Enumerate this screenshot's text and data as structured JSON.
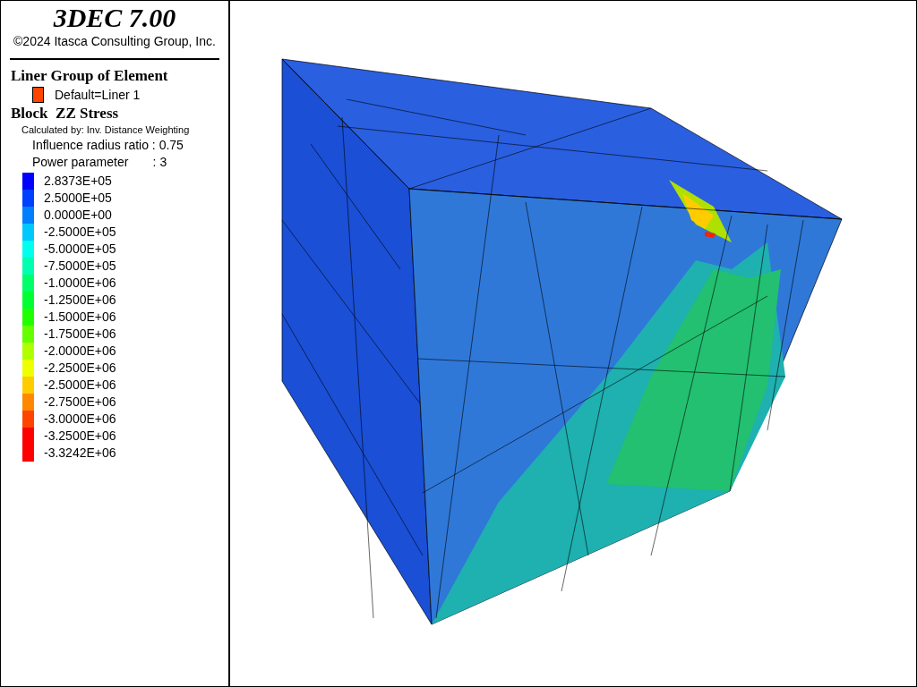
{
  "title": {
    "program": "3DEC 7.00",
    "copyright": "©2024 Itasca Consulting Group, Inc."
  },
  "liner_group": {
    "heading": "Liner Group of Element",
    "items": [
      {
        "label": "Default=Liner 1",
        "color": "#ff4400"
      }
    ]
  },
  "block_contour": {
    "heading": "Block  ZZ Stress",
    "method": "Calculated by: Inv. Distance Weighting",
    "parameters": [
      "Influence radius ratio : 0.75",
      "Power parameter       : 3"
    ],
    "legend": [
      {
        "label": "2.8373E+05",
        "color": "#0000ff"
      },
      {
        "label": "2.5000E+05",
        "color": "#0040ff"
      },
      {
        "label": "0.0000E+00",
        "color": "#0080ff"
      },
      {
        "label": "-2.5000E+05",
        "color": "#00c8ff"
      },
      {
        "label": "-5.0000E+05",
        "color": "#00ffec"
      },
      {
        "label": "-7.5000E+05",
        "color": "#00ffb0"
      },
      {
        "label": "-1.0000E+06",
        "color": "#00ff6a"
      },
      {
        "label": "-1.2500E+06",
        "color": "#00ff30"
      },
      {
        "label": "-1.5000E+06",
        "color": "#20ff00"
      },
      {
        "label": "-1.7500E+06",
        "color": "#66ff00"
      },
      {
        "label": "-2.0000E+06",
        "color": "#b0ff00"
      },
      {
        "label": "-2.2500E+06",
        "color": "#eeff00"
      },
      {
        "label": "-2.5000E+06",
        "color": "#ffcc00"
      },
      {
        "label": "-2.7500E+06",
        "color": "#ff8800"
      },
      {
        "label": "-3.0000E+06",
        "color": "#ff4400"
      },
      {
        "label": "-3.2500E+06",
        "color": "#ff0000"
      },
      {
        "label": "-3.3242E+06",
        "color": "#ff0000"
      }
    ]
  }
}
